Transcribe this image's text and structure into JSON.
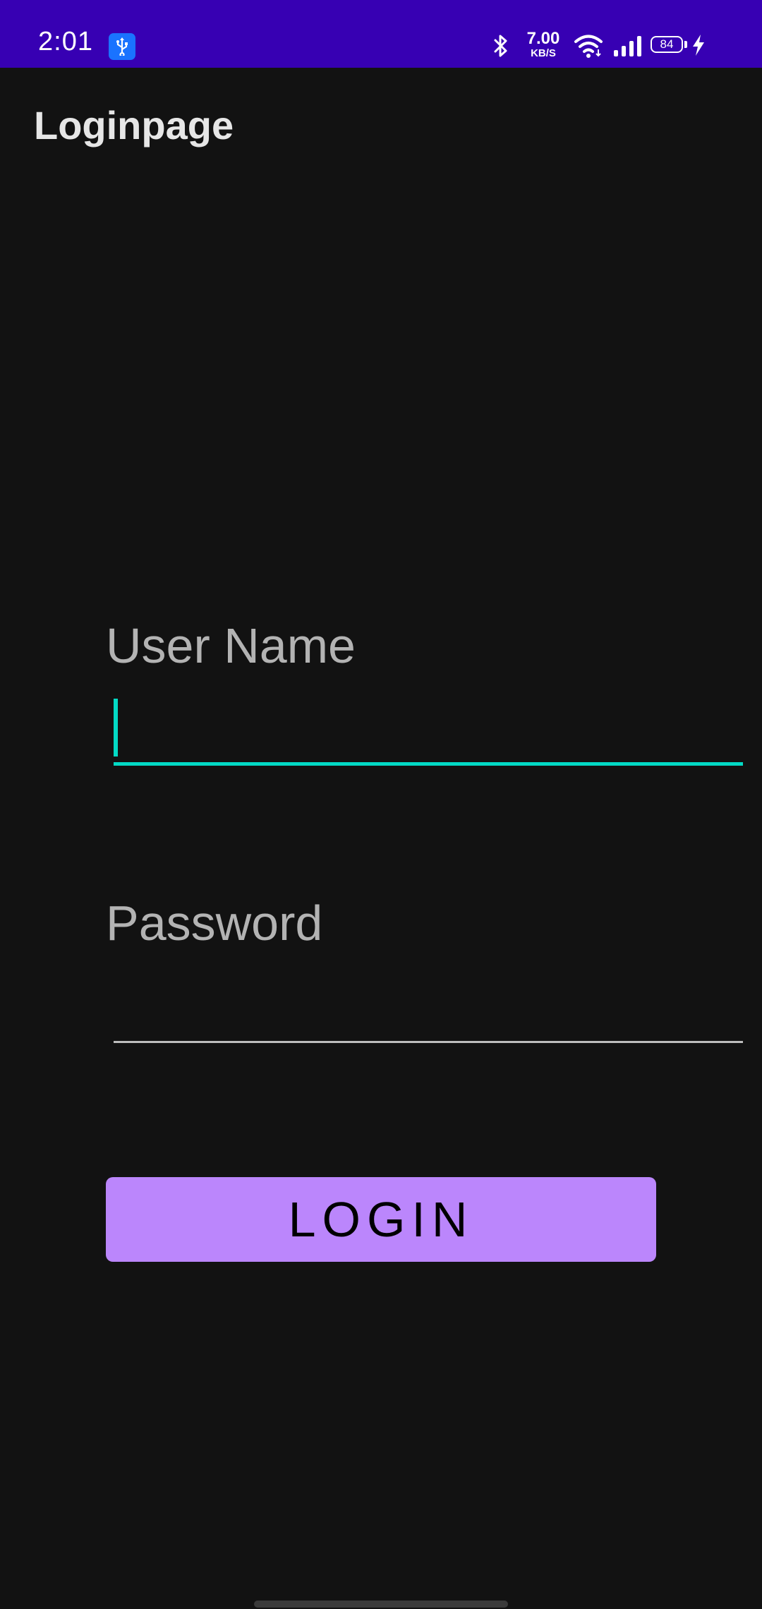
{
  "status_bar": {
    "time": "2:01",
    "net_speed_value": "7.00",
    "net_speed_unit": "KB/S",
    "battery_level": "84",
    "icons": [
      "usb-icon",
      "bluetooth-icon",
      "wifi-icon",
      "signal-icon",
      "battery-icon",
      "charging-icon"
    ],
    "background_color": "#3700B3"
  },
  "app_bar": {
    "title": "Loginpage"
  },
  "form": {
    "username_label": "User Name",
    "username_value": "",
    "password_label": "Password",
    "password_value": "",
    "login_label": "LOGIN"
  },
  "colors": {
    "background": "#121212",
    "accent_focused": "#03DAC5",
    "button": "#BB86FC"
  }
}
